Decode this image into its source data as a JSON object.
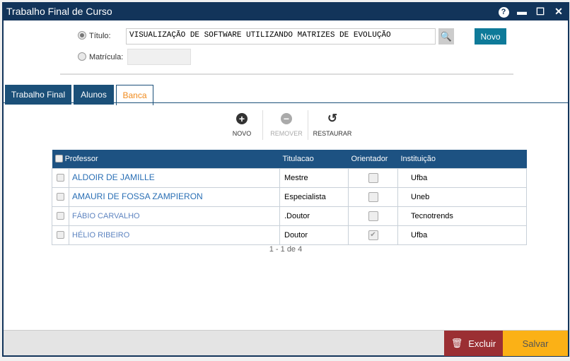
{
  "window": {
    "title": "Trabalho Final de Curso"
  },
  "search": {
    "titulo_label": "Título:",
    "titulo_value": "VISUALIZAÇÃO DE SOFTWARE UTILIZANDO MATRIZES DE EVOLUÇÃO",
    "matricula_label": "Matrícula:",
    "matricula_value": "",
    "novo_label": "Novo"
  },
  "tabs": [
    {
      "label": "Trabalho Final"
    },
    {
      "label": "Alunos"
    },
    {
      "label": "Banca",
      "active": true
    }
  ],
  "toolbar": {
    "novo": "NOVO",
    "remover": "REMOVER",
    "restaurar": "RESTAURAR"
  },
  "table": {
    "headers": {
      "professor": "Professor",
      "titulacao": "Titulacao",
      "orientador": "Orientador",
      "instituicao": "Instituição"
    },
    "rows": [
      {
        "professor": "ALDOIR DE JAMILLE",
        "titulacao": "Mestre",
        "orientador": false,
        "instituicao": "Ufba"
      },
      {
        "professor": "AMAURI DE FOSSA ZAMPIERON",
        "titulacao": "Especialista",
        "orientador": false,
        "instituicao": "Uneb"
      },
      {
        "professor": "FÁBIO CARVALHO",
        "titulacao": ".Doutor",
        "orientador": false,
        "instituicao": "Tecnotrends"
      },
      {
        "professor": "HÉLIO RIBEIRO",
        "titulacao": "Doutor",
        "orientador": true,
        "instituicao": "Ufba"
      }
    ]
  },
  "pagination": "1 - 1 de 4",
  "footer": {
    "excluir": "Excluir",
    "salvar": "Salvar"
  }
}
